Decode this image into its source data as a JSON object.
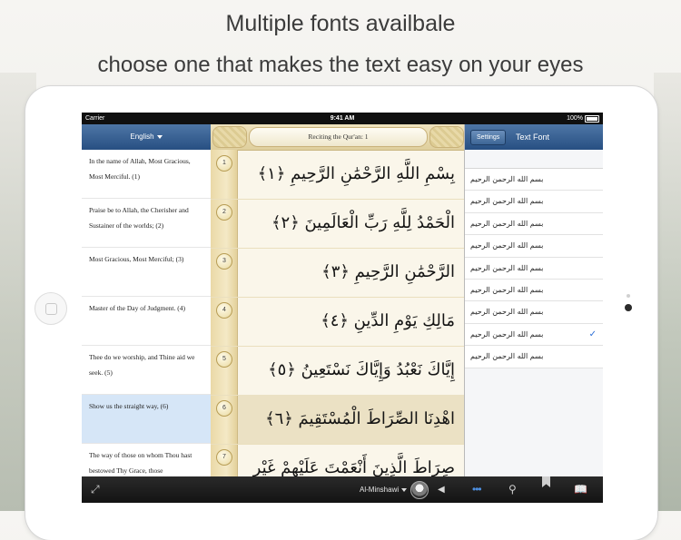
{
  "headline": {
    "line1": "Multiple fonts availbale",
    "line2": "choose one that makes the text easy on your eyes"
  },
  "status_bar": {
    "carrier": "Carrier",
    "time": "9:41 AM",
    "battery": "100%"
  },
  "left_panel": {
    "language": "English",
    "translations": [
      {
        "text": "In the name of Allah, Most Gracious, Most Merciful. (1)",
        "highlighted": false
      },
      {
        "text": "Praise be to Allah, the Cherisher and Sustainer of the worlds; (2)",
        "highlighted": false
      },
      {
        "text": "Most Gracious, Most Merciful; (3)",
        "highlighted": false
      },
      {
        "text": "Master of the Day of Judgment. (4)",
        "highlighted": false
      },
      {
        "text": "Thee do we worship, and Thine aid we seek. (5)",
        "highlighted": false
      },
      {
        "text": "Show us the straight way, (6)",
        "highlighted": true
      },
      {
        "text": "The way of those on whom Thou hast bestowed Thy Grace, those",
        "highlighted": false
      }
    ]
  },
  "center_panel": {
    "title": "Reciting the Qur'an: 1",
    "ayahs": [
      {
        "number": "1",
        "text": "بِسْمِ اللَّهِ الرَّحْمَٰنِ الرَّحِيمِ ﴿١﴾",
        "highlighted": false
      },
      {
        "number": "2",
        "text": "الْحَمْدُ لِلَّهِ رَبِّ الْعَالَمِينَ ﴿٢﴾",
        "highlighted": false
      },
      {
        "number": "3",
        "text": "الرَّحْمَٰنِ الرَّحِيمِ ﴿٣﴾",
        "highlighted": false
      },
      {
        "number": "4",
        "text": "مَالِكِ يَوْمِ الدِّينِ ﴿٤﴾",
        "highlighted": false
      },
      {
        "number": "5",
        "text": "إِيَّاكَ نَعْبُدُ وَإِيَّاكَ نَسْتَعِينُ ﴿٥﴾",
        "highlighted": false
      },
      {
        "number": "6",
        "text": "اهْدِنَا الصِّرَاطَ الْمُسْتَقِيمَ ﴿٦﴾",
        "highlighted": true
      },
      {
        "number": "7",
        "text": "صِرَاطَ الَّذِينَ أَنْعَمْتَ عَلَيْهِمْ غَيْرِ",
        "highlighted": false
      }
    ]
  },
  "right_panel": {
    "back_button": "Settings",
    "title": "Text Font",
    "fonts": [
      {
        "sample": "بسم الله الرحمن الرحيم",
        "selected": false
      },
      {
        "sample": "بسم الله الرحمن الرحيم",
        "selected": false
      },
      {
        "sample": "بسم الله الرحمن الرحيم",
        "selected": false
      },
      {
        "sample": "بسم الله الرحمن الرحيم",
        "selected": false
      },
      {
        "sample": "بسم الله الرحمن الرحيم",
        "selected": false
      },
      {
        "sample": "بسم الله الرحمن الرحيم",
        "selected": false
      },
      {
        "sample": "بسم الله الرحمن الرحيم",
        "selected": false
      },
      {
        "sample": "بسم الله الرحمن الرحيم",
        "selected": true
      },
      {
        "sample": "بسم الله الرحمن الرحيم",
        "selected": false
      }
    ],
    "check_glyph": "✓"
  },
  "toolbar": {
    "reciter": "Al-Minshawi",
    "icons": [
      "expand-icon",
      "speaker-icon",
      "playlist-icon",
      "search-icon",
      "bookmark-icon",
      "book-icon"
    ]
  },
  "colors": {
    "nav_blue": "#274f82",
    "highlight_blue": "#d6e6f7",
    "parchment": "#faf6ea",
    "check_blue": "#2c6fd6"
  }
}
